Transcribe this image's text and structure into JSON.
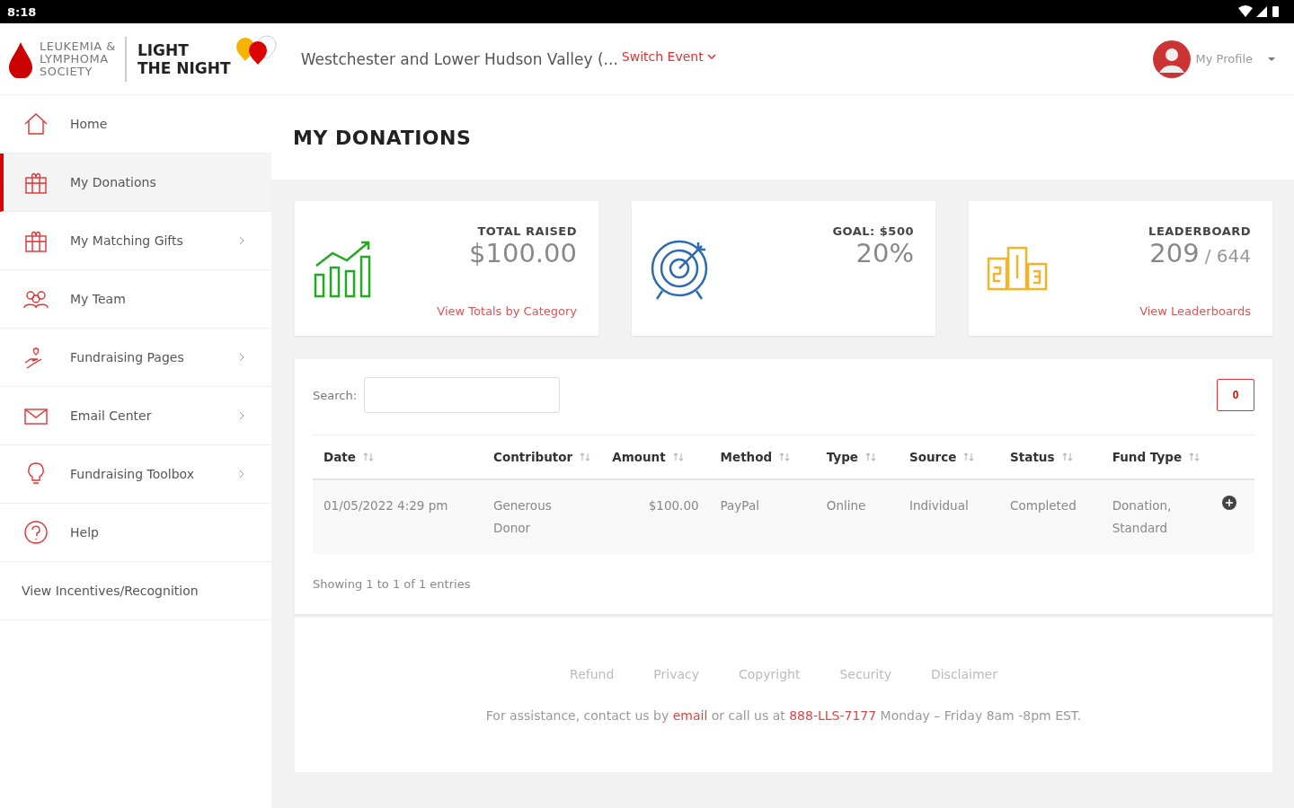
{
  "status_bar": {
    "time": "8:18"
  },
  "header": {
    "org_logo": [
      "LEUKEMIA &",
      "LYMPHOMA",
      "SOCIETY"
    ],
    "event_logo": [
      "LIGHT",
      "THE NIGHT"
    ],
    "event_name": "Westchester and Lower Hudson Valley (...",
    "switch_event": "Switch Event",
    "profile": "My Profile"
  },
  "sidebar": {
    "items": [
      {
        "label": "Home",
        "kind": "home",
        "selected": false,
        "submenu": false
      },
      {
        "label": "My Donations",
        "kind": "gift",
        "selected": true,
        "submenu": false
      },
      {
        "label": "My Matching Gifts",
        "kind": "gift",
        "selected": false,
        "submenu": true
      },
      {
        "label": "My Team",
        "kind": "team",
        "selected": false,
        "submenu": false
      },
      {
        "label": "Fundraising Pages",
        "kind": "hand",
        "selected": false,
        "submenu": true
      },
      {
        "label": "Email Center",
        "kind": "mail",
        "selected": false,
        "submenu": true
      },
      {
        "label": "Fundraising Toolbox",
        "kind": "bulb",
        "selected": false,
        "submenu": true
      },
      {
        "label": "Help",
        "kind": "help",
        "selected": false,
        "submenu": false
      },
      {
        "label": "View Incentives/Recognition",
        "kind": "text",
        "selected": false,
        "submenu": false
      }
    ]
  },
  "page_title": "MY DONATIONS",
  "stats": [
    {
      "kind": "growth",
      "label": "TOTAL RAISED",
      "value": "$100.00",
      "link": "View Totals by Category"
    },
    {
      "kind": "target",
      "label": "GOAL: $500",
      "value": "20%"
    },
    {
      "kind": "podium",
      "label": "LEADERBOARD",
      "value": "209",
      "suffix": "/ 644",
      "link": "View Leaderboards"
    }
  ],
  "table": {
    "search_label": "Search:",
    "count_button": "0",
    "columns": [
      "Date",
      "Contributor",
      "Amount",
      "Method",
      "Type",
      "Source",
      "Status",
      "Fund Type"
    ],
    "rows": [
      [
        "01/05/2022 4:29 pm",
        "Generous Donor",
        "$100.00",
        "PayPal",
        "Online",
        "Individual",
        "Completed",
        "Donation, Standard"
      ]
    ],
    "info": "Showing 1 to 1 of 1 entries"
  },
  "footer": {
    "links": [
      "Refund",
      "Privacy",
      "Copyright",
      "Security",
      "Disclaimer"
    ],
    "assistance": [
      {
        "text": "For assistance, contact us by ",
        "link": false
      },
      {
        "text": "email",
        "link": true
      },
      {
        "text": " or call us at ",
        "link": false
      },
      {
        "text": "888-LLS-7177",
        "link": true
      },
      {
        "text": " Monday – Friday 8am -8pm EST.",
        "link": false
      }
    ]
  }
}
